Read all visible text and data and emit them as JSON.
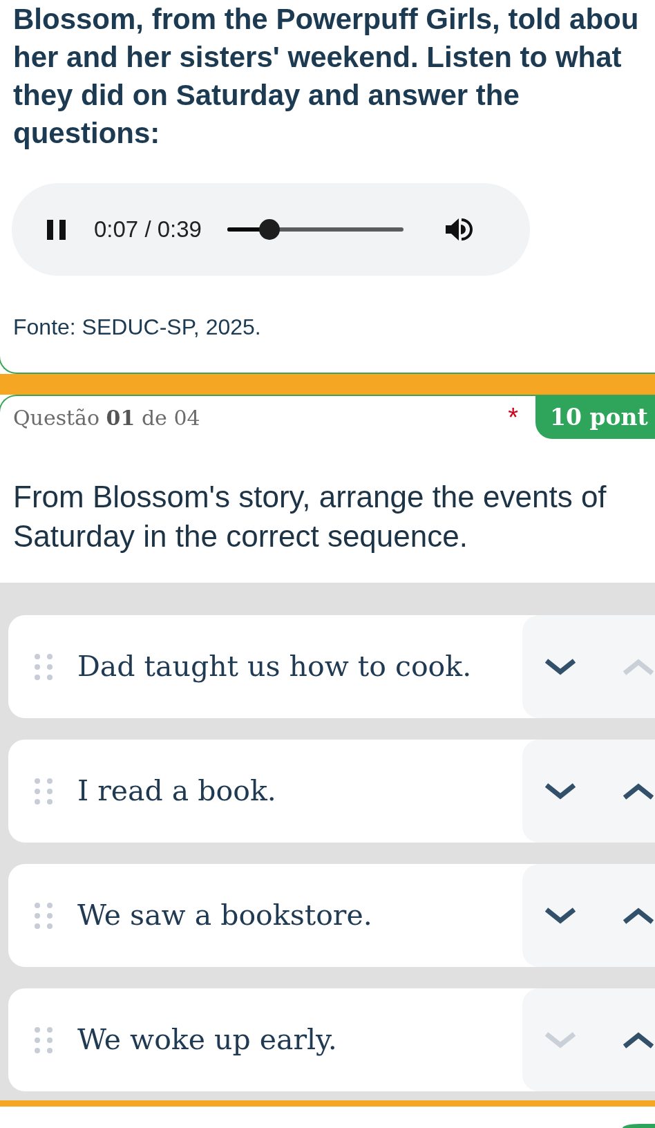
{
  "intro": {
    "lines": [
      "Blossom, from the Powerpuff Girls, told abou",
      "her and her sisters' weekend. Listen to what",
      "they did on Saturday and answer the",
      "questions:"
    ]
  },
  "audio_player": {
    "playing": true,
    "time": "0:07 / 0:39",
    "level": 0.24
  },
  "source": "Fonte: SEDUC-SP, 2025.",
  "question": {
    "counter": "Questão **01** de 04",
    "required_mark": "*",
    "points": "10 pont",
    "prompt": "From Blossom's story, arrange the events of Saturday in the correct sequence."
  },
  "answers": [
    {
      "text": "Dad taught us how to cook.",
      "move_down_disabled": false,
      "move_up_disabled": true
    },
    {
      "text": "I read a book.",
      "move_down_disabled": false,
      "move_up_disabled": false
    },
    {
      "text": "We saw a bookstore.",
      "move_down_disabled": false,
      "move_up_disabled": false
    },
    {
      "text": "We woke up early.",
      "move_down_disabled": true,
      "move_up_disabled": false
    }
  ]
}
